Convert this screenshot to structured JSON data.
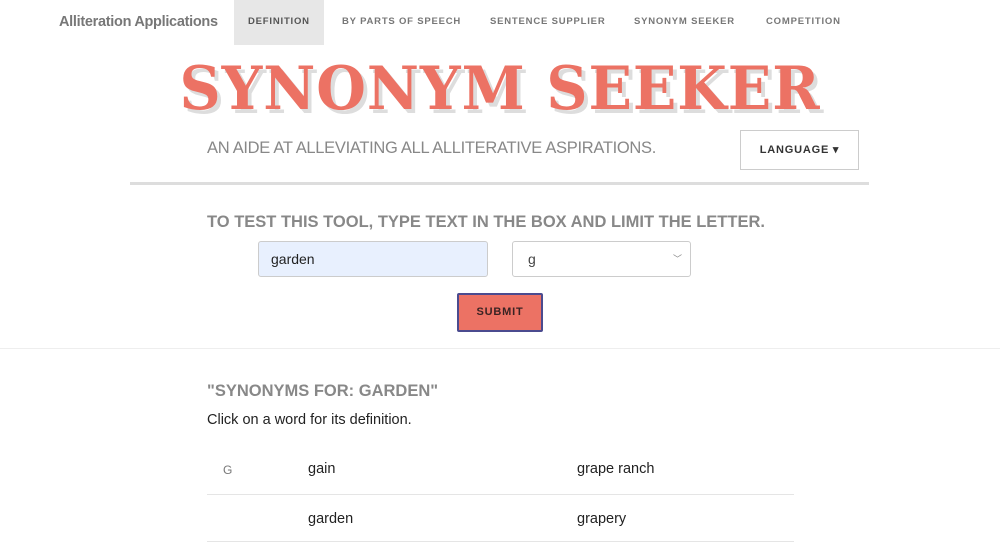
{
  "nav": {
    "brand": "Alliteration Applications",
    "items": [
      {
        "label": "DEFINITION",
        "active": true
      },
      {
        "label": "BY PARTS OF SPEECH"
      },
      {
        "label": "SENTENCE SUPPLIER"
      },
      {
        "label": "SYNONYM SEEKER"
      },
      {
        "label": "COMPETITION"
      }
    ]
  },
  "header": {
    "title": "SYNONYM SEEKER",
    "tagline": "AN AIDE AT ALLEVIATING ALL ALLITERATIVE ASPIRATIONS.",
    "language_label": "LANGUAGE ▾"
  },
  "form": {
    "instructions": "TO TEST THIS TOOL, TYPE TEXT IN THE BOX AND LIMIT THE LETTER.",
    "text_value": "garden",
    "letter_value": "g",
    "submit_label": "SUBMIT"
  },
  "results": {
    "heading": "\"SYNONYMS FOR: GARDEN\"",
    "hint": "Click on a word for its definition.",
    "rows": [
      {
        "letter": "G",
        "col1": "gain",
        "col2": "grape ranch"
      },
      {
        "letter": "",
        "col1": "garden",
        "col2": "grapery"
      }
    ]
  },
  "colors": {
    "accent": "#ec7264"
  }
}
